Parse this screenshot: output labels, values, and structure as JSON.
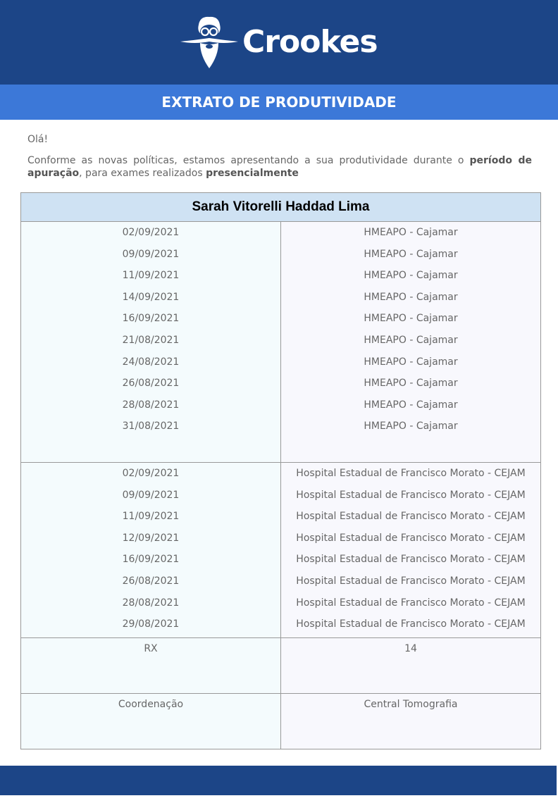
{
  "brand": {
    "name": "Crookes",
    "colors": {
      "header": "#1c4587",
      "title_bar": "#3c78d8",
      "name_row": "#cfe2f3"
    },
    "logo_icon": "professor-mascot-icon"
  },
  "title": "EXTRATO DE PRODUTIVIDADE",
  "intro": {
    "greeting": "Olá!",
    "text_1": "Conforme as novas políticas, estamos apresentando a sua produtividade durante o ",
    "bold_1": "período de apuração",
    "text_2": ", para exames realizados ",
    "bold_2": "presencialmente"
  },
  "report": {
    "person_name": "Sarah Vitorelli Haddad Lima",
    "groups": [
      {
        "location": "HMEAPO - Cajamar",
        "dates": [
          "02/09/2021",
          "09/09/2021",
          "11/09/2021",
          "14/09/2021",
          "16/09/2021",
          "21/08/2021",
          "24/08/2021",
          "26/08/2021",
          "28/08/2021",
          "31/08/2021"
        ]
      },
      {
        "location": "Hospital Estadual de Francisco Morato - CEJAM",
        "dates": [
          "02/09/2021",
          "09/09/2021",
          "11/09/2021",
          "12/09/2021",
          "16/09/2021",
          "26/08/2021",
          "28/08/2021",
          "29/08/2021"
        ]
      }
    ],
    "exam_type": "RX",
    "exam_count": "14",
    "coord_label": "Coordenação",
    "coord_value": "Central Tomografia"
  }
}
